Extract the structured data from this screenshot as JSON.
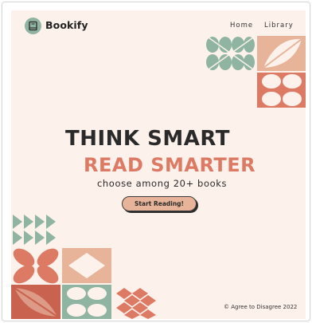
{
  "header": {
    "brand_name": "Bookify",
    "nav": [
      {
        "label": "Home"
      },
      {
        "label": "Library"
      }
    ]
  },
  "hero": {
    "headline_line1": "THINK SMART",
    "headline_line2": "READ SMARTER",
    "subtitle": "choose among 20+ books",
    "cta_label": "Start Reading!"
  },
  "footer": {
    "copyright": "© Agree to Disagree 2022"
  },
  "colors": {
    "background": "#fdf1ec",
    "accent_orange": "#dd7a63",
    "sage_green": "#8fb4a1",
    "peach": "#e8b499",
    "text_dark": "#2a2a2a"
  },
  "icons": {
    "logo": "book-icon"
  }
}
